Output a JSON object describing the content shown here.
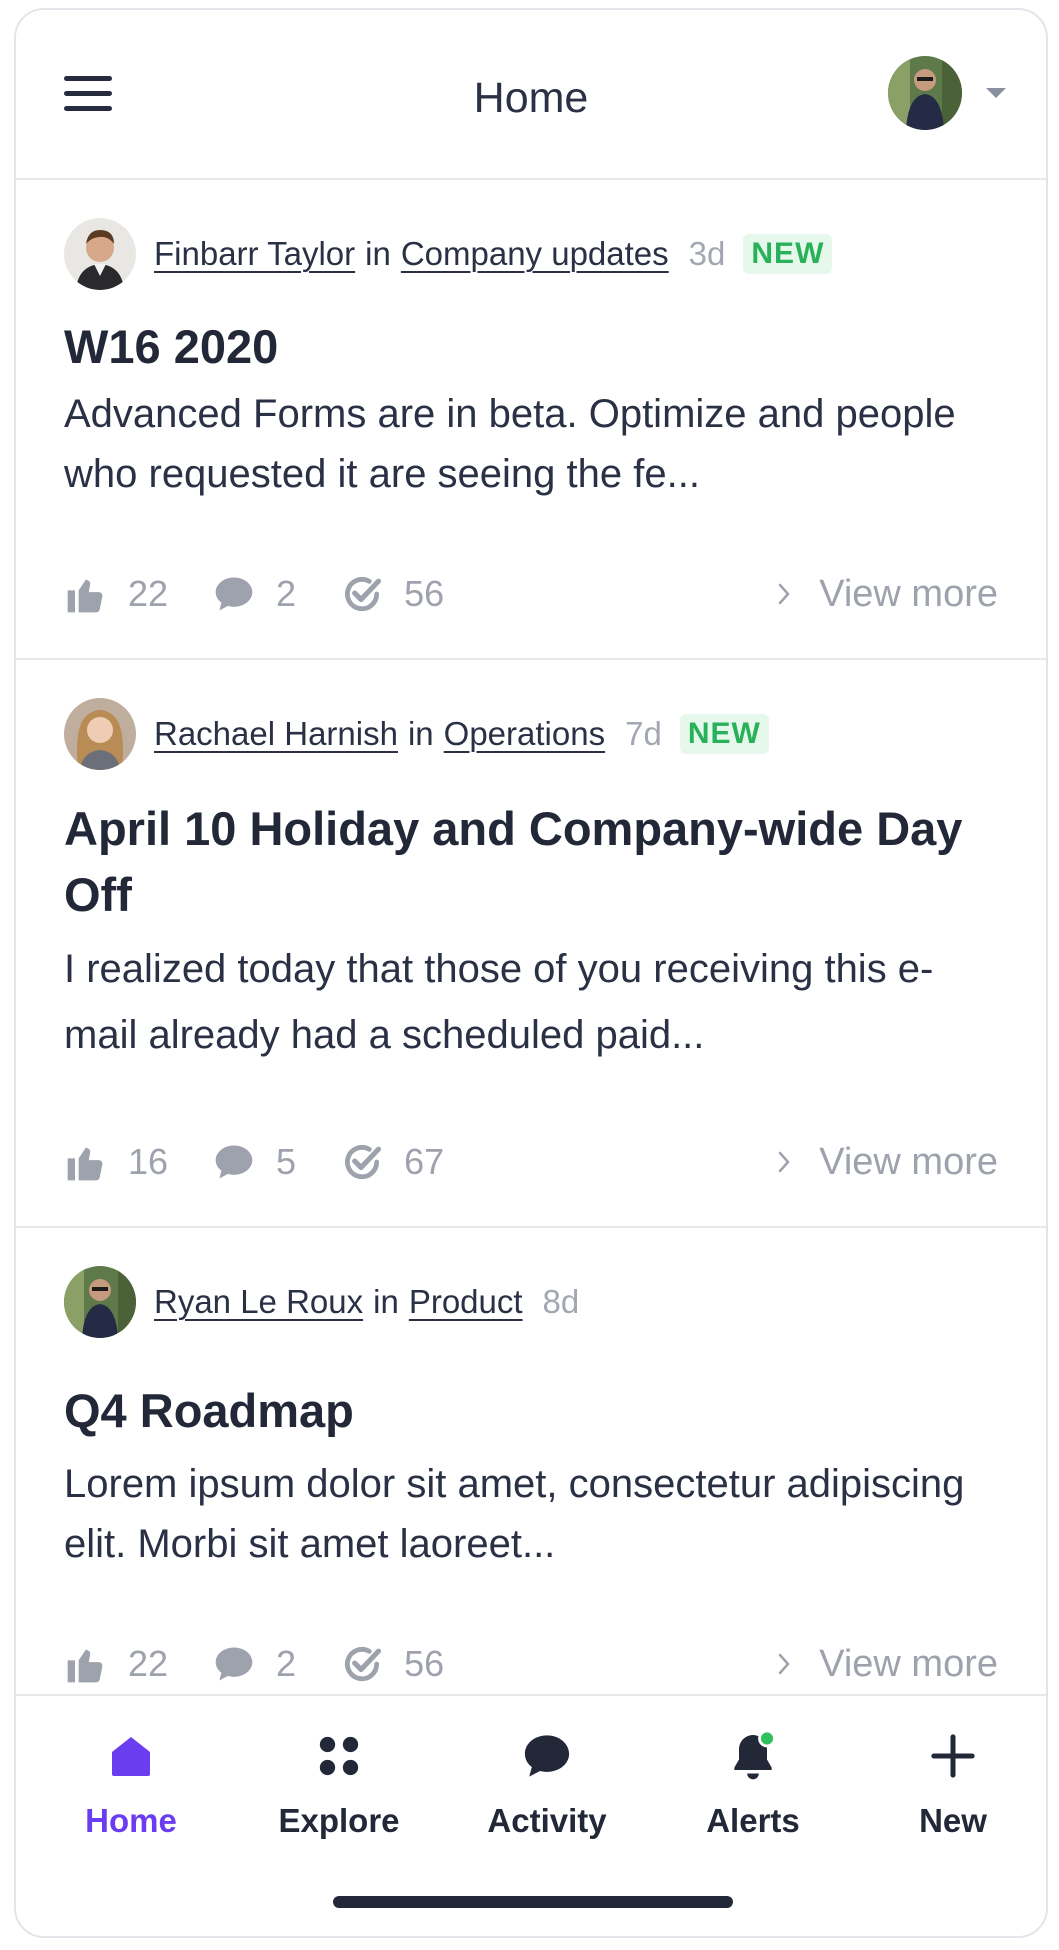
{
  "header": {
    "title": "Home",
    "menu_icon": "hamburger-icon",
    "avatar_icon": "user-avatar",
    "dropdown_icon": "caret-down-icon"
  },
  "posts": [
    {
      "author": "Finbarr Taylor",
      "in": "in",
      "channel": "Company updates",
      "time": "3d",
      "badge": "NEW",
      "title": "W16 2020",
      "excerpt": "Advanced Forms are in beta. Optimize and people who requested it are seeing the fe...",
      "likes": "22",
      "comments": "2",
      "views": "56",
      "view_more": "View more"
    },
    {
      "author": "Rachael Harnish",
      "in": "in",
      "channel": "Operations",
      "time": "7d",
      "badge": "NEW",
      "title": "April 10 Holiday and Company-wide Day Off",
      "excerpt": "I realized today that those of you receiving this e-mail already had a scheduled paid...",
      "likes": "16",
      "comments": "5",
      "views": "67",
      "view_more": "View more"
    },
    {
      "author": "Ryan Le Roux",
      "in": "in",
      "channel": "Product",
      "time": "8d",
      "title": "Q4 Roadmap",
      "excerpt": "Lorem ipsum dolor sit amet, consectetur adipiscing elit. Morbi sit amet laoreet...",
      "likes": "22",
      "comments": "2",
      "views": "56",
      "view_more": "View more"
    }
  ],
  "nav": {
    "items": [
      {
        "label": "Home",
        "icon": "home-icon",
        "active": true
      },
      {
        "label": "Explore",
        "icon": "explore-icon"
      },
      {
        "label": "Activity",
        "icon": "activity-icon"
      },
      {
        "label": "Alerts",
        "icon": "bell-icon",
        "has_dot": true
      },
      {
        "label": "New",
        "icon": "plus-icon"
      }
    ]
  },
  "colors": {
    "accent": "#6a3df0",
    "badge_text": "#29b15a",
    "badge_bg": "#e6f8ec",
    "text": "#2b3145",
    "muted": "#9ea2ad",
    "notification_dot": "#2fbf5f"
  }
}
